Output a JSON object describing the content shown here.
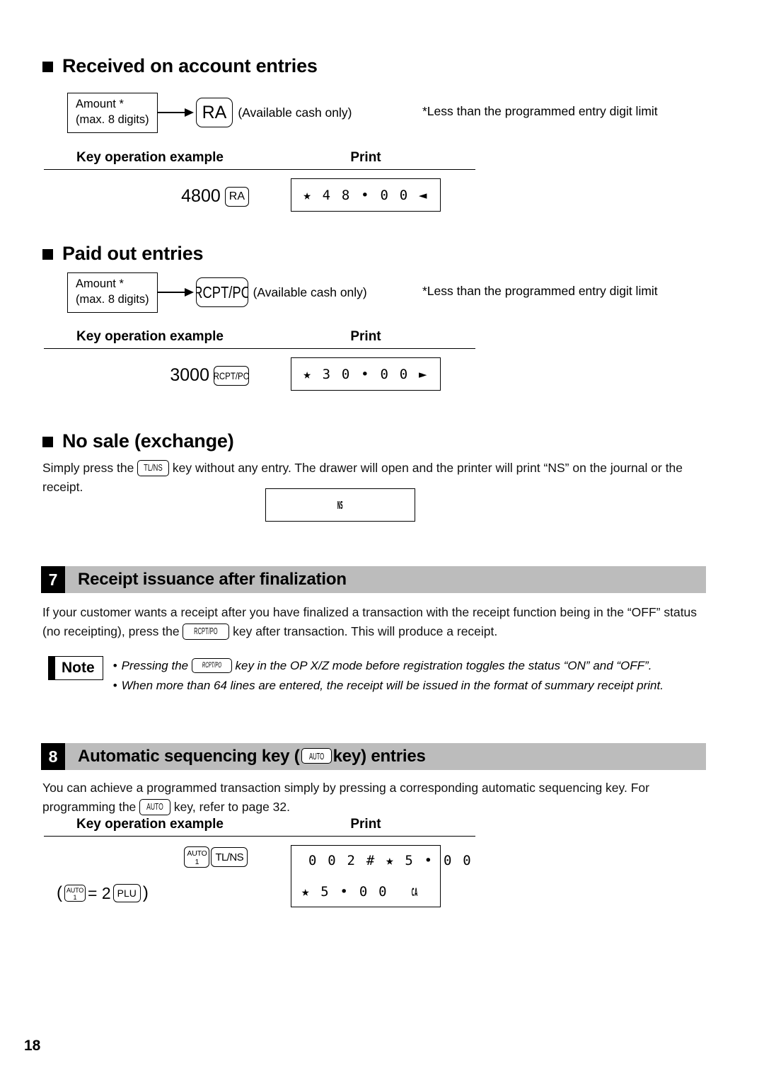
{
  "page": {
    "number": "18"
  },
  "sections": {
    "ra": {
      "heading": "Received on account entries",
      "flow": {
        "amount_line1": "Amount *",
        "amount_line2": "(max. 8 digits)",
        "key_label": "RA",
        "key_note": "(Available cash only)"
      },
      "footnote": "*Less than the programmed entry digit limit",
      "table": {
        "col_left_title": "Key operation example",
        "col_right_title": "Print",
        "operation_amount": "4800",
        "operation_key": "RA",
        "print_line": "★ 4 8 • 0 0 ◄"
      }
    },
    "po": {
      "heading": "Paid out entries",
      "flow": {
        "amount_line1": "Amount *",
        "amount_line2": "(max. 8 digits)",
        "key_label": "RCPT/PO",
        "key_note": "(Available cash only)"
      },
      "footnote": "*Less than the programmed entry digit limit",
      "table": {
        "col_left_title": "Key operation example",
        "col_right_title": "Print",
        "operation_amount": "3000",
        "operation_key": "RCPT/PO",
        "print_line": "★ 3 0 • 0 0 ►"
      }
    },
    "nosale": {
      "heading": "No sale (exchange)",
      "text_part1": "Simply press the ",
      "inline_key": "TL/NS",
      "text_part2": " key without any entry.  The drawer will open and the printer will print “NS” on the journal or the receipt.",
      "print_line": "NS"
    },
    "receipt_issuance": {
      "number": "7",
      "title": "Receipt issuance after finalization",
      "para_part1": "If your customer wants a receipt after you have finalized a transaction with the receipt function being in the “OFF” status (no receipting), press the ",
      "inline_key": "RCPT/PO",
      "para_part2": " key after transaction. This will produce a receipt.",
      "note": {
        "badge": "Note",
        "items": [
          {
            "bullet": "•",
            "part1": "Pressing the ",
            "inline_key": "RCPT/PO",
            "part2": " key in the OP X/Z mode before registration toggles the status “ON” and “OFF”."
          },
          {
            "bullet": "•",
            "part1": "When more than 64 lines are entered, the receipt will be issued in the format of summary receipt print.",
            "inline_key": "",
            "part2": ""
          }
        ]
      }
    },
    "auto_sequencing": {
      "number": "8",
      "title_part1": "Automatic sequencing key (",
      "title_key": "AUTO",
      "title_part2": " key) entries",
      "para_part1": "You can achieve a programmed transaction simply by pressing a corresponding automatic sequencing key. For programming the ",
      "inline_key": "AUTO",
      "para_part2": " key, refer to page 32.",
      "table": {
        "col_left_title": "Key operation example",
        "col_right_title": "Print",
        "op_key1_l1": "AUTO",
        "op_key1_l2": "1",
        "op_key2": "TL/NS",
        "equation_open": "(",
        "eq_key_l1": "AUTO",
        "eq_key_l2": "1",
        "equation_mid": " = 2 ",
        "eq_key2": "PLU",
        "equation_close": ")",
        "print_line1": "0 0 2 # ★ 5 • 0 0",
        "print_line2": "★ 5 • 0 0",
        "print_line2_tag": "CA"
      }
    }
  },
  "colors": {
    "band_grey": "#bcbcbc",
    "band_num_bg": "#000000",
    "text": "#000000",
    "paper": "#ffffff"
  }
}
